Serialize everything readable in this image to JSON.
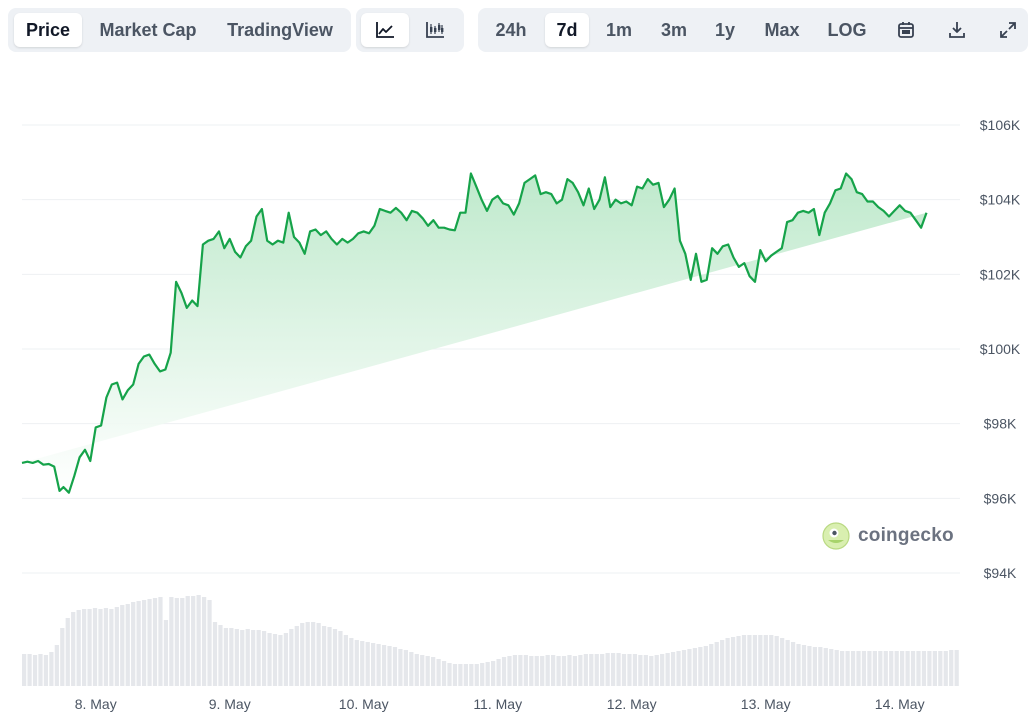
{
  "toolbar": {
    "tabs": [
      "Price",
      "Market Cap",
      "TradingView"
    ],
    "active_tab": "Price",
    "chart_types": [
      "line-chart-icon",
      "candlestick-chart-icon"
    ],
    "ranges": [
      "24h",
      "7d",
      "1m",
      "3m",
      "1y",
      "Max",
      "LOG"
    ],
    "active_range": "7d",
    "tools": [
      "calendar-icon",
      "download-icon",
      "expand-icon"
    ]
  },
  "watermark": "coingecko",
  "colors": {
    "line": "#16a34a",
    "fill_top": "#bbe8c9",
    "volume": "#e5e7eb",
    "grid": "#eef0f3"
  },
  "chart_data": {
    "type": "area",
    "xlabel": "",
    "ylabel": "",
    "ylim": [
      94000,
      106000
    ],
    "y_ticks": [
      "$106K",
      "$104K",
      "$102K",
      "$100K",
      "$98K",
      "$96K",
      "$94K"
    ],
    "y_tick_values": [
      106000,
      104000,
      102000,
      100000,
      98000,
      96000,
      94000
    ],
    "x_ticks": [
      "8. May",
      "9. May",
      "10. May",
      "11. May",
      "12. May",
      "13. May",
      "14. May"
    ],
    "x_tick_values": [
      0.55,
      1.55,
      2.55,
      3.55,
      4.55,
      5.55,
      6.55
    ],
    "xlim": [
      0,
      7
    ],
    "price_x": [
      0.0,
      0.04,
      0.08,
      0.12,
      0.16,
      0.2,
      0.24,
      0.28,
      0.31,
      0.35,
      0.39,
      0.43,
      0.47,
      0.51,
      0.55,
      0.59,
      0.63,
      0.67,
      0.71,
      0.75,
      0.79,
      0.83,
      0.87,
      0.91,
      0.95,
      0.99,
      1.03,
      1.07,
      1.11,
      1.15,
      1.19,
      1.23,
      1.27,
      1.31,
      1.35,
      1.39,
      1.43,
      1.47,
      1.51,
      1.55,
      1.59,
      1.63,
      1.67,
      1.71,
      1.75,
      1.79,
      1.83,
      1.87,
      1.91,
      1.95,
      1.99,
      2.03,
      2.07,
      2.11,
      2.15,
      2.19,
      2.23,
      2.27,
      2.31,
      2.35,
      2.39,
      2.43,
      2.47,
      2.51,
      2.55,
      2.59,
      2.63,
      2.67,
      2.71,
      2.75,
      2.79,
      2.83,
      2.87,
      2.91,
      2.95,
      2.99,
      3.03,
      3.07,
      3.11,
      3.15,
      3.19,
      3.23,
      3.27,
      3.31,
      3.35,
      3.39,
      3.43,
      3.47,
      3.51,
      3.55,
      3.59,
      3.63,
      3.67,
      3.71,
      3.75,
      3.79,
      3.83,
      3.87,
      3.91,
      3.95,
      3.99,
      4.03,
      4.07,
      4.11,
      4.15,
      4.19,
      4.23,
      4.27,
      4.31,
      4.35,
      4.39,
      4.43,
      4.47,
      4.51,
      4.55,
      4.59,
      4.63,
      4.67,
      4.71,
      4.75,
      4.79,
      4.83,
      4.87,
      4.91,
      4.95,
      4.99,
      5.03,
      5.07,
      5.11,
      5.15,
      5.19,
      5.23,
      5.27,
      5.31,
      5.35,
      5.39,
      5.43,
      5.47,
      5.51,
      5.55,
      5.59,
      5.63,
      5.67,
      5.71,
      5.75,
      5.79,
      5.83,
      5.87,
      5.91,
      5.95,
      5.99,
      6.03,
      6.07,
      6.11,
      6.15,
      6.19,
      6.23,
      6.27,
      6.31,
      6.35,
      6.39,
      6.43,
      6.47,
      6.51,
      6.55,
      6.59,
      6.63,
      6.67,
      6.71,
      6.75,
      6.79,
      6.83,
      6.87,
      6.91,
      6.95,
      6.99
    ],
    "price_y": [
      96950,
      96980,
      96950,
      97000,
      96900,
      96920,
      96850,
      96200,
      96300,
      96150,
      96600,
      97100,
      97300,
      97000,
      97900,
      97950,
      98700,
      99050,
      99100,
      98650,
      98900,
      99050,
      99600,
      99800,
      99850,
      99600,
      99400,
      99450,
      99900,
      101800,
      101500,
      101100,
      101300,
      101150,
      102800,
      102900,
      102950,
      103150,
      102700,
      102950,
      102600,
      102450,
      102750,
      102900,
      103550,
      103750,
      102900,
      102800,
      102900,
      102850,
      103650,
      103000,
      102850,
      102550,
      103150,
      103200,
      103050,
      103150,
      102950,
      102800,
      102950,
      102850,
      102950,
      103100,
      103150,
      103100,
      103300,
      103750,
      103700,
      103650,
      103780,
      103650,
      103450,
      103700,
      103650,
      103500,
      103300,
      103450,
      103250,
      103250,
      103200,
      103180,
      103650,
      103650,
      104700,
      104350,
      104000,
      103700,
      104000,
      104100,
      103900,
      103850,
      103600,
      103900,
      104450,
      104550,
      104650,
      104150,
      104200,
      104150,
      103900,
      104000,
      104550,
      104450,
      104200,
      103850,
      104300,
      103750,
      104000,
      104600,
      103800,
      104000,
      103900,
      103950,
      103850,
      104350,
      104300,
      104550,
      104400,
      104450,
      103800,
      104000,
      104300,
      102900,
      102550,
      101850,
      102550,
      101800,
      101850,
      102700,
      102550,
      102750,
      102800,
      102450,
      102200,
      102300,
      101950,
      101800,
      102650,
      102350,
      102500,
      102600,
      102700,
      103400,
      103450,
      103650,
      103700,
      103650,
      103750,
      103050,
      103650,
      103900,
      104250,
      104300,
      104700,
      104550,
      104200,
      104150,
      103950,
      103950,
      103800,
      103700,
      103550,
      103700,
      103850,
      103700,
      103650,
      103450,
      103250,
      103650
    ],
    "volume": [
      32,
      32,
      31,
      32,
      31,
      34,
      41,
      58,
      68,
      74,
      76,
      77,
      77,
      78,
      77,
      78,
      77,
      79,
      81,
      82,
      84,
      85,
      86,
      87,
      88,
      89,
      66,
      89,
      88,
      88,
      90,
      90,
      91,
      89,
      86,
      64,
      61,
      58,
      58,
      57,
      56,
      57,
      56,
      56,
      55,
      53,
      52,
      51,
      53,
      57,
      60,
      63,
      64,
      64,
      63,
      60,
      59,
      57,
      55,
      51,
      48,
      46,
      45,
      44,
      43,
      42,
      41,
      40,
      39,
      37,
      36,
      34,
      32,
      31,
      30,
      29,
      27,
      25,
      23,
      22,
      22,
      22,
      22,
      22,
      23,
      24,
      25,
      27,
      29,
      30,
      31,
      31,
      31,
      30,
      30,
      30,
      31,
      31,
      30,
      30,
      31,
      30,
      31,
      32,
      32,
      32,
      32,
      33,
      33,
      33,
      32,
      32,
      32,
      31,
      31,
      30,
      31,
      32,
      33,
      34,
      35,
      36,
      37,
      38,
      39,
      40,
      42,
      44,
      46,
      48,
      49,
      50,
      51,
      51,
      51,
      51,
      51,
      51,
      50,
      48,
      46,
      44,
      42,
      41,
      40,
      39,
      39,
      38,
      37,
      36,
      35,
      35,
      35,
      35,
      35,
      35,
      35,
      35,
      35,
      35,
      35,
      35,
      35,
      35,
      35,
      35,
      35,
      35,
      35,
      35,
      36,
      36
    ]
  }
}
